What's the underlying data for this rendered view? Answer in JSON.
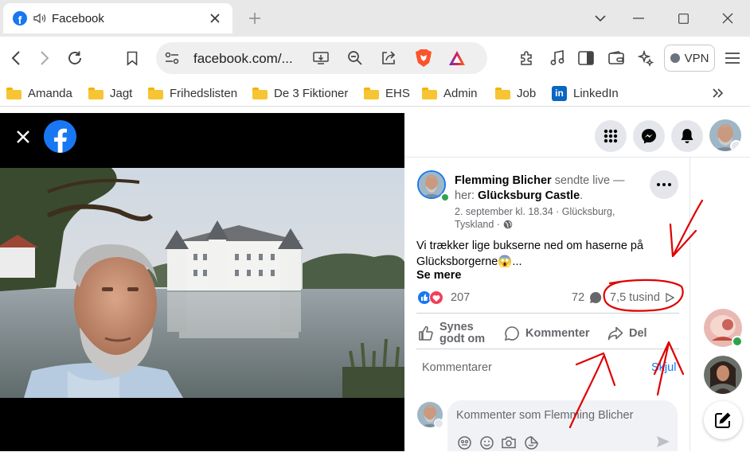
{
  "browser": {
    "tab_title": "Facebook",
    "url": "facebook.com/...",
    "vpn_label": "VPN",
    "bookmarks": [
      {
        "label": "Amanda",
        "icon": "folder-icon"
      },
      {
        "label": "Jagt",
        "icon": "folder-icon"
      },
      {
        "label": "Frihedslisten",
        "icon": "folder-icon"
      },
      {
        "label": "De 3 Fiktioner",
        "icon": "folder-icon"
      },
      {
        "label": "EHS",
        "icon": "folder-icon"
      },
      {
        "label": "Admin",
        "icon": "folder-icon"
      },
      {
        "label": "Job",
        "icon": "folder-icon"
      },
      {
        "label": "LinkedIn",
        "icon": "linkedin-icon"
      }
    ],
    "linkedin_glyph": "in"
  },
  "post": {
    "author": "Flemming Blicher",
    "action_text": "sendte live —",
    "here_prefix": "her:",
    "location": "Glücksburg Castle",
    "location_suffix": ".",
    "meta_line1": "2. september kl. 18.34 · Glücksburg,",
    "meta_line2": "Tyskland ·",
    "text_line1": "Vi trækker lige bukserne ned om haserne på",
    "text_line2": "Glücksborgerne😱...",
    "see_more": "Se mere",
    "reaction_count": "207",
    "comment_count": "72",
    "view_count": "7,5 tusind",
    "actions": {
      "like_line1": "Synes",
      "like_line2": "godt om",
      "comment": "Kommenter",
      "share": "Del"
    },
    "comments_header": "Kommentarer",
    "hide_label": "Skjul",
    "comment_placeholder": "Kommenter som Flemming Blicher"
  },
  "colors": {
    "facebook_blue": "#1877f2",
    "annotation_red": "#e00000",
    "online_green": "#31a24c"
  }
}
